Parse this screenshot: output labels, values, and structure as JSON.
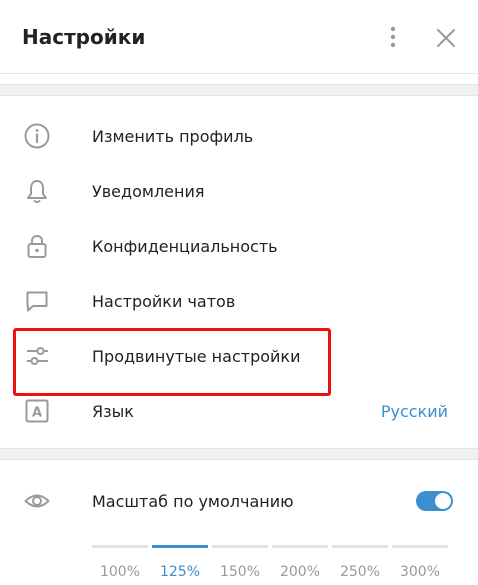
{
  "header": {
    "title": "Настройки"
  },
  "menu": {
    "items": [
      {
        "label": "Изменить профиль",
        "icon": "info-icon"
      },
      {
        "label": "Уведомления",
        "icon": "bell-icon"
      },
      {
        "label": "Конфиденциальность",
        "icon": "lock-icon"
      },
      {
        "label": "Настройки чатов",
        "icon": "chat-bubble-icon"
      },
      {
        "label": "Продвинутые настройки",
        "icon": "sliders-icon"
      },
      {
        "label": "Язык",
        "icon": "language-icon",
        "value": "Русский"
      }
    ]
  },
  "zoom": {
    "label": "Масштаб по умолчанию",
    "icon": "eye-icon",
    "toggle_on": true,
    "options": [
      "100%",
      "125%",
      "150%",
      "200%",
      "250%",
      "300%"
    ],
    "selected": "125%"
  },
  "colors": {
    "accent": "#3a8fcf",
    "highlight_border": "#ee1111",
    "icon_gray": "#9a9a9a",
    "toggle_on": "#3a8fcf"
  }
}
